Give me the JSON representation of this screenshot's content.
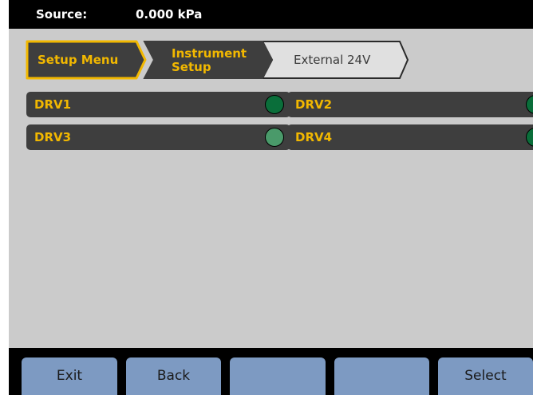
{
  "status": {
    "label": "Source:",
    "value": "0.000 kPa"
  },
  "breadcrumb": {
    "items": [
      {
        "label": "Setup Menu"
      },
      {
        "label_line1": "Instrument",
        "label_line2": "Setup"
      },
      {
        "label": "External 24V"
      }
    ]
  },
  "drives": [
    {
      "label": "DRV1",
      "led_color": "#0a6e3a"
    },
    {
      "label": "DRV2",
      "led_color": "#0a6e3a"
    },
    {
      "label": "DRV3",
      "led_color": "#4a9a6a"
    },
    {
      "label": "DRV4",
      "led_color": "#0a6e3a"
    }
  ],
  "softkeys": [
    {
      "label": "Exit"
    },
    {
      "label": "Back"
    },
    {
      "label": ""
    },
    {
      "label": ""
    },
    {
      "label": "Select"
    }
  ],
  "colors": {
    "accent": "#f2b800",
    "softkey": "#7d9ac2",
    "panel": "#3e3e3e",
    "background": "#cbcbcb"
  }
}
